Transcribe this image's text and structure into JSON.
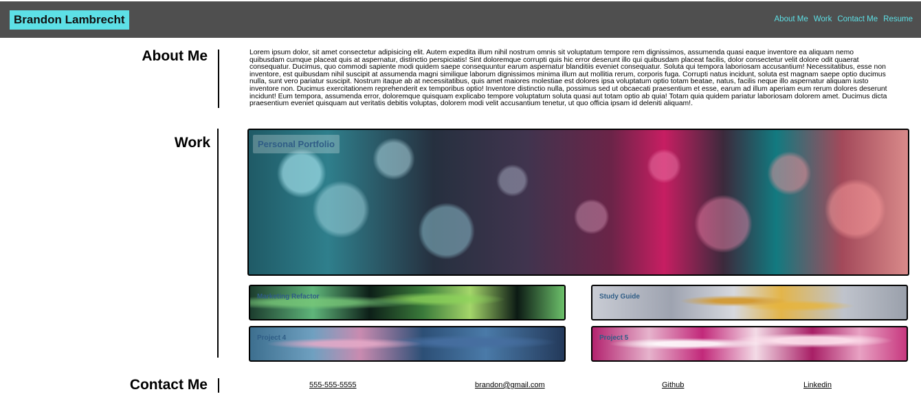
{
  "header": {
    "brand": "Brandon Lambrecht",
    "nav": [
      "About Me",
      "Work",
      "Contact Me",
      "Resume"
    ]
  },
  "about": {
    "title": "About Me",
    "text": "Lorem ipsum dolor, sit amet consectetur adipisicing elit. Autem expedita illum nihil nostrum omnis sit voluptatum tempore rem dignissimos, assumenda quasi eaque inventore ea aliquam nemo quibusdam cumque placeat quis at aspernatur, distinctio perspiciatis! Sint doloremque corrupti quis hic error deserunt illo qui quibusdam placeat facilis, dolor consectetur velit dolore odit quaerat consequatur. Ducimus, quo commodi sapiente modi quidem saepe consequuntur earum aspernatur blanditiis eveniet consequatur. Soluta qui tempora laboriosam accusantium! Necessitatibus, esse non inventore, est quibusdam nihil suscipit at assumenda magni similique laborum dignissimos minima illum aut mollitia rerum, corporis fuga. Corrupti natus incidunt, soluta est magnam saepe optio ducimus nulla, sunt vero pariatur suscipit. Nostrum itaque ab at necessitatibus, quis amet maiores molestiae est dolores ipsa voluptatum optio totam beatae, natus, facilis neque illo aspernatur aliquam iusto inventore non. Ducimus exercitationem reprehenderit ex temporibus optio! Inventore distinctio nulla, possimus sed ut obcaecati praesentium et esse, earum ad illum aperiam eum rerum dolores deserunt incidunt! Eum tempora, assumenda error, doloremque quisquam explicabo tempore voluptatum soluta quasi aut totam optio ab quia! Totam quia quidem pariatur laboriosam dolorem amet. Ducimus dicta praesentium eveniet quisquam aut veritatis debitis voluptas, dolorem modi velit accusantium tenetur, ut quo officia ipsam id deleniti aliquam!."
  },
  "work": {
    "title": "Work",
    "main_project": "Personal Portfolio",
    "projects": [
      "Marketing Refactor",
      "Study Guide",
      "Project 4",
      "Project 5"
    ]
  },
  "contact": {
    "title": "Contact Me",
    "phone": "555-555-5555",
    "email": "brandon@gmail.com",
    "github": "Github",
    "linkedin": "Linkedin"
  },
  "colors": {
    "header_bg": "#4f4f4f",
    "accent": "#5de0e6",
    "project_label": "#2f5d86"
  }
}
